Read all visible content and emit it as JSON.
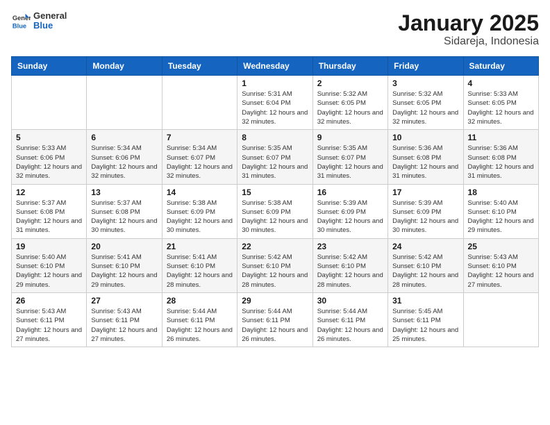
{
  "header": {
    "logo_general": "General",
    "logo_blue": "Blue",
    "title": "January 2025",
    "subtitle": "Sidareja, Indonesia"
  },
  "days_of_week": [
    "Sunday",
    "Monday",
    "Tuesday",
    "Wednesday",
    "Thursday",
    "Friday",
    "Saturday"
  ],
  "weeks": [
    [
      {
        "day": "",
        "sunrise": "",
        "sunset": "",
        "daylight": ""
      },
      {
        "day": "",
        "sunrise": "",
        "sunset": "",
        "daylight": ""
      },
      {
        "day": "",
        "sunrise": "",
        "sunset": "",
        "daylight": ""
      },
      {
        "day": "1",
        "sunrise": "Sunrise: 5:31 AM",
        "sunset": "Sunset: 6:04 PM",
        "daylight": "Daylight: 12 hours and 32 minutes."
      },
      {
        "day": "2",
        "sunrise": "Sunrise: 5:32 AM",
        "sunset": "Sunset: 6:05 PM",
        "daylight": "Daylight: 12 hours and 32 minutes."
      },
      {
        "day": "3",
        "sunrise": "Sunrise: 5:32 AM",
        "sunset": "Sunset: 6:05 PM",
        "daylight": "Daylight: 12 hours and 32 minutes."
      },
      {
        "day": "4",
        "sunrise": "Sunrise: 5:33 AM",
        "sunset": "Sunset: 6:05 PM",
        "daylight": "Daylight: 12 hours and 32 minutes."
      }
    ],
    [
      {
        "day": "5",
        "sunrise": "Sunrise: 5:33 AM",
        "sunset": "Sunset: 6:06 PM",
        "daylight": "Daylight: 12 hours and 32 minutes."
      },
      {
        "day": "6",
        "sunrise": "Sunrise: 5:34 AM",
        "sunset": "Sunset: 6:06 PM",
        "daylight": "Daylight: 12 hours and 32 minutes."
      },
      {
        "day": "7",
        "sunrise": "Sunrise: 5:34 AM",
        "sunset": "Sunset: 6:07 PM",
        "daylight": "Daylight: 12 hours and 32 minutes."
      },
      {
        "day": "8",
        "sunrise": "Sunrise: 5:35 AM",
        "sunset": "Sunset: 6:07 PM",
        "daylight": "Daylight: 12 hours and 31 minutes."
      },
      {
        "day": "9",
        "sunrise": "Sunrise: 5:35 AM",
        "sunset": "Sunset: 6:07 PM",
        "daylight": "Daylight: 12 hours and 31 minutes."
      },
      {
        "day": "10",
        "sunrise": "Sunrise: 5:36 AM",
        "sunset": "Sunset: 6:08 PM",
        "daylight": "Daylight: 12 hours and 31 minutes."
      },
      {
        "day": "11",
        "sunrise": "Sunrise: 5:36 AM",
        "sunset": "Sunset: 6:08 PM",
        "daylight": "Daylight: 12 hours and 31 minutes."
      }
    ],
    [
      {
        "day": "12",
        "sunrise": "Sunrise: 5:37 AM",
        "sunset": "Sunset: 6:08 PM",
        "daylight": "Daylight: 12 hours and 31 minutes."
      },
      {
        "day": "13",
        "sunrise": "Sunrise: 5:37 AM",
        "sunset": "Sunset: 6:08 PM",
        "daylight": "Daylight: 12 hours and 30 minutes."
      },
      {
        "day": "14",
        "sunrise": "Sunrise: 5:38 AM",
        "sunset": "Sunset: 6:09 PM",
        "daylight": "Daylight: 12 hours and 30 minutes."
      },
      {
        "day": "15",
        "sunrise": "Sunrise: 5:38 AM",
        "sunset": "Sunset: 6:09 PM",
        "daylight": "Daylight: 12 hours and 30 minutes."
      },
      {
        "day": "16",
        "sunrise": "Sunrise: 5:39 AM",
        "sunset": "Sunset: 6:09 PM",
        "daylight": "Daylight: 12 hours and 30 minutes."
      },
      {
        "day": "17",
        "sunrise": "Sunrise: 5:39 AM",
        "sunset": "Sunset: 6:09 PM",
        "daylight": "Daylight: 12 hours and 30 minutes."
      },
      {
        "day": "18",
        "sunrise": "Sunrise: 5:40 AM",
        "sunset": "Sunset: 6:10 PM",
        "daylight": "Daylight: 12 hours and 29 minutes."
      }
    ],
    [
      {
        "day": "19",
        "sunrise": "Sunrise: 5:40 AM",
        "sunset": "Sunset: 6:10 PM",
        "daylight": "Daylight: 12 hours and 29 minutes."
      },
      {
        "day": "20",
        "sunrise": "Sunrise: 5:41 AM",
        "sunset": "Sunset: 6:10 PM",
        "daylight": "Daylight: 12 hours and 29 minutes."
      },
      {
        "day": "21",
        "sunrise": "Sunrise: 5:41 AM",
        "sunset": "Sunset: 6:10 PM",
        "daylight": "Daylight: 12 hours and 28 minutes."
      },
      {
        "day": "22",
        "sunrise": "Sunrise: 5:42 AM",
        "sunset": "Sunset: 6:10 PM",
        "daylight": "Daylight: 12 hours and 28 minutes."
      },
      {
        "day": "23",
        "sunrise": "Sunrise: 5:42 AM",
        "sunset": "Sunset: 6:10 PM",
        "daylight": "Daylight: 12 hours and 28 minutes."
      },
      {
        "day": "24",
        "sunrise": "Sunrise: 5:42 AM",
        "sunset": "Sunset: 6:10 PM",
        "daylight": "Daylight: 12 hours and 28 minutes."
      },
      {
        "day": "25",
        "sunrise": "Sunrise: 5:43 AM",
        "sunset": "Sunset: 6:10 PM",
        "daylight": "Daylight: 12 hours and 27 minutes."
      }
    ],
    [
      {
        "day": "26",
        "sunrise": "Sunrise: 5:43 AM",
        "sunset": "Sunset: 6:11 PM",
        "daylight": "Daylight: 12 hours and 27 minutes."
      },
      {
        "day": "27",
        "sunrise": "Sunrise: 5:43 AM",
        "sunset": "Sunset: 6:11 PM",
        "daylight": "Daylight: 12 hours and 27 minutes."
      },
      {
        "day": "28",
        "sunrise": "Sunrise: 5:44 AM",
        "sunset": "Sunset: 6:11 PM",
        "daylight": "Daylight: 12 hours and 26 minutes."
      },
      {
        "day": "29",
        "sunrise": "Sunrise: 5:44 AM",
        "sunset": "Sunset: 6:11 PM",
        "daylight": "Daylight: 12 hours and 26 minutes."
      },
      {
        "day": "30",
        "sunrise": "Sunrise: 5:44 AM",
        "sunset": "Sunset: 6:11 PM",
        "daylight": "Daylight: 12 hours and 26 minutes."
      },
      {
        "day": "31",
        "sunrise": "Sunrise: 5:45 AM",
        "sunset": "Sunset: 6:11 PM",
        "daylight": "Daylight: 12 hours and 25 minutes."
      },
      {
        "day": "",
        "sunrise": "",
        "sunset": "",
        "daylight": ""
      }
    ]
  ]
}
